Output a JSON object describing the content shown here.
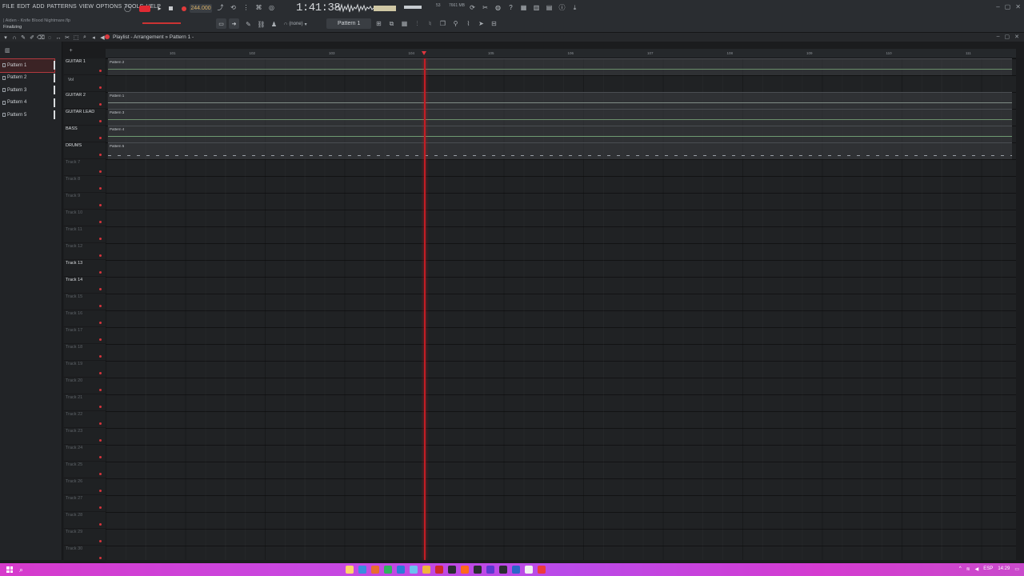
{
  "menu": [
    "FILE",
    "EDIT",
    "ADD",
    "PATTERNS",
    "VIEW",
    "OPTIONS",
    "TOOLS",
    "HELP"
  ],
  "project_title": "| Aiden - Knife Blood Nightmare.flp",
  "status": "Finalizing",
  "tempo": "244.000",
  "time_display": "1:41:38",
  "cpu": "53",
  "memory": "7661 MB",
  "snap": "(none)",
  "pattern_select": "Pattern 1",
  "playlist_title": "Playlist - Arrangement » Pattern 1 -",
  "picker_items": [
    "Pattern 1",
    "Pattern 2",
    "Pattern 3",
    "Pattern 4",
    "Pattern 5"
  ],
  "tracks": [
    {
      "name": "GUITAR 1",
      "style": "bright"
    },
    {
      "name": "Vol",
      "style": "sub"
    },
    {
      "name": "GUITAR 2",
      "style": "bright"
    },
    {
      "name": "GUITAR LEAD",
      "style": "bright"
    },
    {
      "name": "BASS",
      "style": "bright"
    },
    {
      "name": "DRUMS",
      "style": "bright"
    },
    {
      "name": "Track 7",
      "style": "dim"
    },
    {
      "name": "Track 8",
      "style": "dim"
    },
    {
      "name": "Track 9",
      "style": "dim"
    },
    {
      "name": "Track 10",
      "style": "dim"
    },
    {
      "name": "Track 11",
      "style": "dim"
    },
    {
      "name": "Track 12",
      "style": "dim"
    },
    {
      "name": "Track 13",
      "style": "bright"
    },
    {
      "name": "Track 14",
      "style": "bright"
    },
    {
      "name": "Track 15",
      "style": "dim"
    },
    {
      "name": "Track 16",
      "style": "dim"
    },
    {
      "name": "Track 17",
      "style": "dim"
    },
    {
      "name": "Track 18",
      "style": "dim"
    },
    {
      "name": "Track 19",
      "style": "dim"
    },
    {
      "name": "Track 20",
      "style": "dim"
    },
    {
      "name": "Track 21",
      "style": "dim"
    },
    {
      "name": "Track 22",
      "style": "dim"
    },
    {
      "name": "Track 23",
      "style": "dim"
    },
    {
      "name": "Track 24",
      "style": "dim"
    },
    {
      "name": "Track 25",
      "style": "dim"
    },
    {
      "name": "Track 26",
      "style": "dim"
    },
    {
      "name": "Track 27",
      "style": "dim"
    },
    {
      "name": "Track 28",
      "style": "dim"
    },
    {
      "name": "Track 29",
      "style": "dim"
    },
    {
      "name": "Track 30",
      "style": "dim"
    }
  ],
  "clips": [
    {
      "label": "Pattern 2",
      "track": 0
    },
    {
      "label": "Pattern 1",
      "track": 2
    },
    {
      "label": "Pattern 3",
      "track": 3
    },
    {
      "label": "Pattern 4",
      "track": 4
    },
    {
      "label": "Pattern 5",
      "track": 5
    }
  ],
  "bars": [
    "101",
    "102",
    "103",
    "104",
    "105",
    "106",
    "107",
    "108",
    "109",
    "110",
    "111"
  ],
  "playhead_bar": 104.2,
  "colors": {
    "accent": "#e02a33",
    "playhead": "#c41d24",
    "grid_bg": "#202224",
    "taskbar": "#c847e0"
  },
  "tray": {
    "lang": "ESP",
    "time": "14:29"
  }
}
